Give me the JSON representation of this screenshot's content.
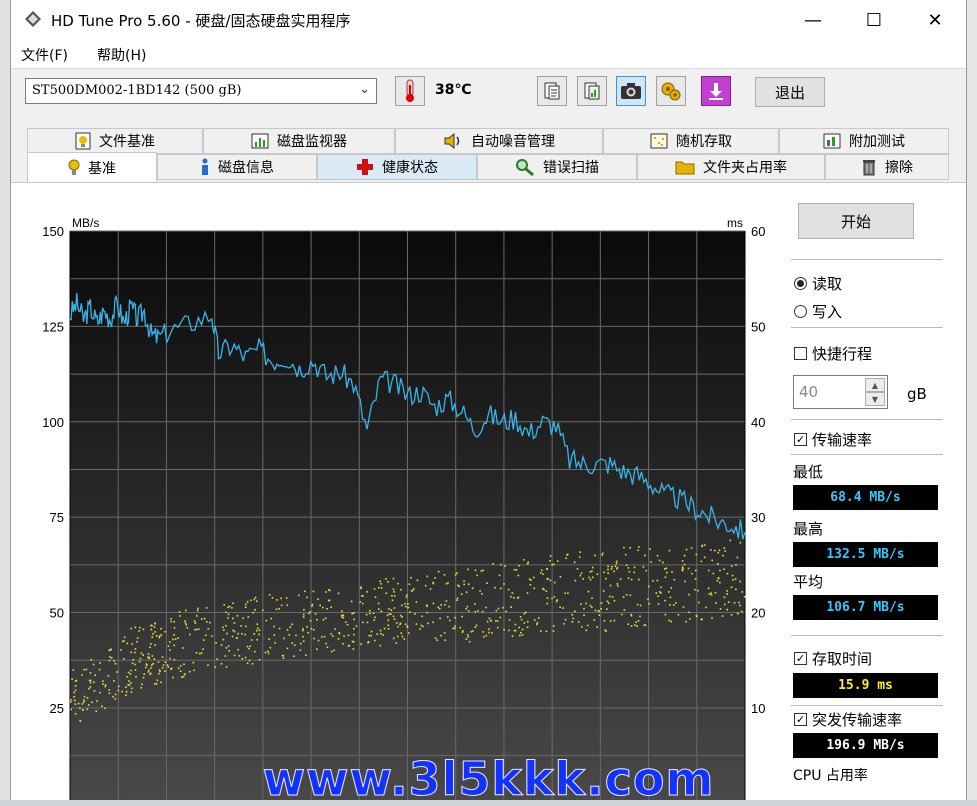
{
  "window": {
    "title": "HD Tune Pro 5.60 - 硬盘/固态硬盘实用程序",
    "minimize": "—",
    "maximize": "☐",
    "close": "✕"
  },
  "menu": [
    "文件(F)",
    "帮助(H)"
  ],
  "toolbar": {
    "drive": "ST500DM002-1BD142 (500 gB)",
    "temperature": "38℃",
    "exit_label": "退出",
    "icons": [
      "copy-text-icon",
      "copy-image-icon",
      "screenshot-icon",
      "options-icon",
      "save-icon"
    ]
  },
  "tabs_row1": [
    {
      "label": "文件基准",
      "icon": "file-benchmark-icon"
    },
    {
      "label": "磁盘监视器",
      "icon": "disk-monitor-icon"
    },
    {
      "label": "自动噪音管理",
      "icon": "speaker-icon"
    },
    {
      "label": "随机存取",
      "icon": "random-access-icon"
    },
    {
      "label": "附加测试",
      "icon": "extra-tests-icon"
    }
  ],
  "tabs_row2": [
    {
      "label": "基准",
      "icon": "benchmark-icon"
    },
    {
      "label": "磁盘信息",
      "icon": "info-icon"
    },
    {
      "label": "健康状态",
      "icon": "health-cross-icon"
    },
    {
      "label": "错误扫描",
      "icon": "magnifier-icon"
    },
    {
      "label": "文件夹占用率",
      "icon": "folder-icon"
    },
    {
      "label": "擦除",
      "icon": "trash-icon"
    }
  ],
  "side": {
    "start_label": "开始",
    "read_label": "读取",
    "write_label": "写入",
    "short_stroke_label": "快捷行程",
    "short_stroke_value": "40",
    "unit_gb": "gB",
    "transfer_rate_label": "传输速率",
    "min_label": "最低",
    "min_value": "68.4 MB/s",
    "max_label": "最高",
    "max_value": "132.5 MB/s",
    "avg_label": "平均",
    "avg_value": "106.7 MB/s",
    "access_time_label": "存取时间",
    "access_time_value": "15.9 ms",
    "burst_label": "突发传输速率",
    "burst_value": "196.9 MB/s",
    "cpu_label": "CPU 占用率"
  },
  "watermark": "www.3l5kkk.com",
  "colors": {
    "transfer_line": "#3ab4e6",
    "access_dots": "#e6e03a",
    "plot_bg_top": "#0a0a0a",
    "plot_bg_bottom": "#4a4a4a"
  },
  "chart_data": {
    "type": "line",
    "left_axis_unit": "MB/s",
    "right_axis_unit": "ms",
    "left_ticks": [
      25,
      50,
      75,
      100,
      125,
      150
    ],
    "right_ticks": [
      10,
      20,
      30,
      40,
      50,
      60
    ],
    "ylim_left": [
      0,
      150
    ],
    "ylim_right": [
      0,
      60
    ],
    "xlim": [
      0,
      1
    ],
    "series": [
      {
        "type": "line",
        "x": [
          0.0,
          0.01,
          0.02,
          0.03,
          0.04,
          0.05,
          0.06,
          0.07,
          0.08,
          0.09,
          0.1,
          0.11,
          0.12,
          0.13,
          0.15,
          0.18,
          0.21,
          0.22,
          0.24,
          0.26,
          0.28,
          0.3,
          0.32,
          0.34,
          0.36,
          0.38,
          0.4,
          0.42,
          0.44,
          0.46,
          0.48,
          0.5,
          0.52,
          0.54,
          0.56,
          0.58,
          0.6,
          0.62,
          0.64,
          0.66,
          0.68,
          0.7,
          0.72,
          0.74,
          0.76,
          0.78,
          0.8,
          0.82,
          0.84,
          0.86,
          0.88,
          0.9,
          0.92,
          0.94,
          0.96,
          0.98,
          1.0
        ],
        "values": [
          128,
          131,
          127,
          130,
          126,
          129,
          127,
          131,
          126,
          130,
          127,
          129,
          123,
          122,
          124,
          126,
          128,
          118,
          120,
          117,
          119,
          116,
          117,
          114,
          116,
          112,
          113,
          110,
          98,
          111,
          110,
          107,
          108,
          104,
          106,
          103,
          98,
          102,
          100,
          101,
          97,
          100,
          99,
          90,
          89,
          89,
          89,
          87,
          86,
          84,
          81,
          80,
          78,
          76,
          74,
          73,
          71
        ]
      },
      {
        "type": "scatter",
        "axis": "right",
        "band_low": [
          8,
          12,
          14,
          15,
          16,
          17,
          17,
          18,
          18,
          19,
          20
        ],
        "band_high": [
          14,
          19,
          21,
          22,
          23,
          24,
          25,
          26,
          27,
          27,
          28
        ],
        "x": [
          0.0,
          0.1,
          0.2,
          0.3,
          0.4,
          0.5,
          0.6,
          0.7,
          0.8,
          0.9,
          1.0
        ]
      }
    ]
  }
}
